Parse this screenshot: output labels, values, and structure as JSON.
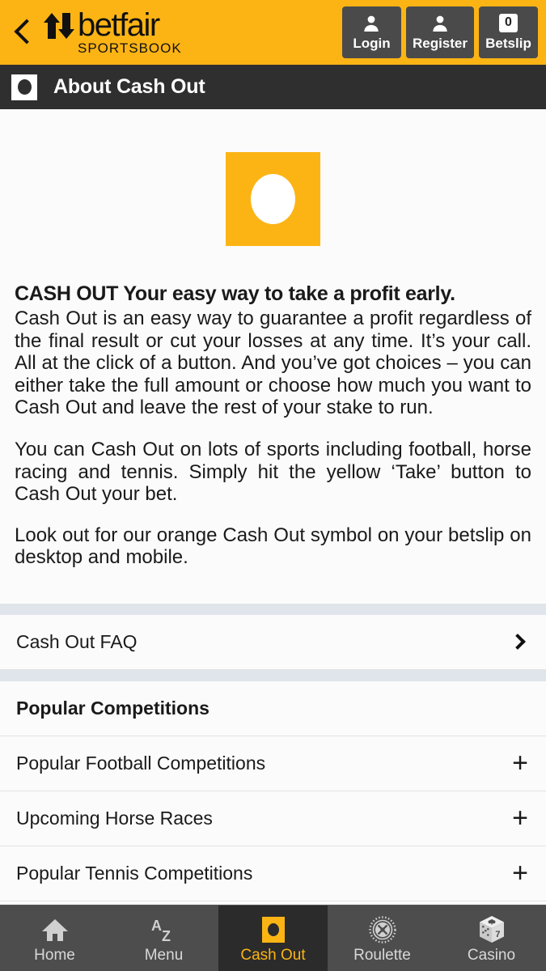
{
  "header": {
    "back_icon": "chevron-left-icon",
    "brand": "betfair",
    "brand_sub": "SPORTSBOOK",
    "brand_color": "#FCB415",
    "actions": [
      {
        "id": "login",
        "label": "Login",
        "icon": "person-icon"
      },
      {
        "id": "register",
        "label": "Register",
        "icon": "person-icon"
      },
      {
        "id": "betslip",
        "label": "Betslip",
        "icon": "betslip-count-badge",
        "count": "0"
      }
    ]
  },
  "subheader": {
    "icon": "cash-out-symbol-icon",
    "title": "About Cash Out"
  },
  "hero": {
    "icon": "cash-out-logo-icon",
    "bg_color": "#FCB415"
  },
  "article": {
    "heading": "CASH OUT  Your easy way to take a profit early.",
    "paragraphs": [
      "Cash Out is an easy way to guarantee a profit regardless of the final result or cut your losses at any time. It’s your call. All at the click of a button. And you’ve got choices – you can either take the full amount or choose how much you want to Cash Out and leave the rest of your stake to run.",
      "You can Cash Out on lots of sports including football, horse racing and tennis. Simply hit the yellow ‘Take’ button to Cash Out your bet.",
      "Look out for our orange Cash Out symbol on your betslip on desktop and mobile."
    ]
  },
  "faq_row": {
    "label": "Cash Out FAQ",
    "chevron": "chevron-right-icon"
  },
  "competitions": {
    "section_title": "Popular Competitions",
    "items": [
      {
        "label": "Popular Football Competitions",
        "expand_icon": "plus-icon"
      },
      {
        "label": "Upcoming Horse Races",
        "expand_icon": "plus-icon"
      },
      {
        "label": "Popular Tennis Competitions",
        "expand_icon": "plus-icon"
      }
    ]
  },
  "bottom_nav": {
    "active": "Cash Out",
    "active_color": "#FCB415",
    "items": [
      {
        "label": "Home",
        "icon": "home-icon",
        "active": false
      },
      {
        "label": "Menu",
        "icon": "a-to-z-icon",
        "active": false
      },
      {
        "label": "Cash Out",
        "icon": "cash-out-symbol-icon",
        "active": true
      },
      {
        "label": "Roulette",
        "icon": "roulette-wheel-icon",
        "active": false
      },
      {
        "label": "Casino",
        "icon": "dice-icon",
        "active": false
      }
    ]
  }
}
